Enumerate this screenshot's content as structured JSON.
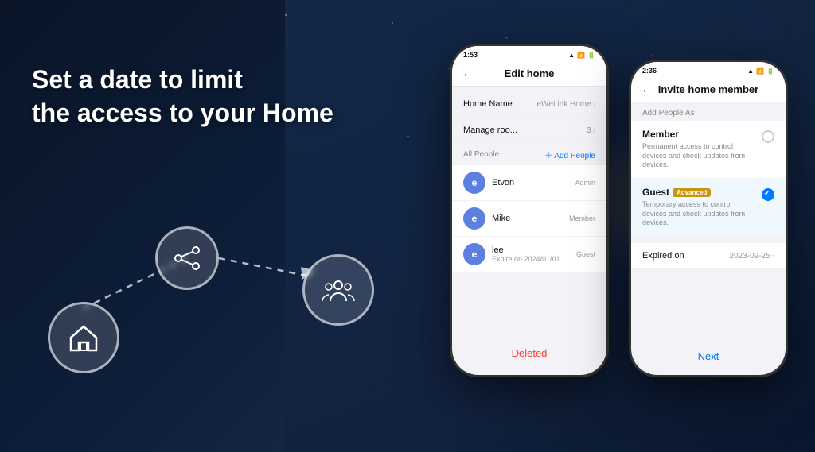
{
  "background": {
    "color": "#0a1628"
  },
  "hero": {
    "line1": "Set a date to limit",
    "line2": "the access to your Home"
  },
  "phone1": {
    "statusBar": {
      "time": "1:53",
      "icons": "🔋▲"
    },
    "header": {
      "back": "←",
      "title": "Edit home"
    },
    "listItems": [
      {
        "label": "Home Name",
        "value": "eWeLink Home",
        "hasChevron": true
      },
      {
        "label": "Manage roo...",
        "value": "3",
        "hasChevron": true
      }
    ],
    "sectionHeader": {
      "left": "All People",
      "right": "＋ Add People"
    },
    "people": [
      {
        "initial": "e",
        "name": "Etvon",
        "role": "Admin",
        "expire": ""
      },
      {
        "initial": "e",
        "name": "Mike",
        "role": "Member",
        "expire": ""
      },
      {
        "initial": "e",
        "name": "lee",
        "role": "Guest",
        "expire": "Expire on 2024/01/01"
      }
    ],
    "deleteBtn": "Deleted"
  },
  "phone2": {
    "statusBar": {
      "time": "2:36",
      "icons": "🔋"
    },
    "header": {
      "back": "←",
      "title": "Invite home member"
    },
    "sectionLabel": "Add People As",
    "options": [
      {
        "label": "Member",
        "badge": "",
        "description": "Permanent access to control devices and check updates from devices.",
        "selected": false
      },
      {
        "label": "Guest",
        "badge": "Advanced",
        "description": "Temporary access to control devices and check updates from devices.",
        "selected": true
      }
    ],
    "expiredLabel": "Expired on",
    "expiredValue": "2023-09-25",
    "nextBtn": "Next"
  },
  "icons": {
    "home": "⌂",
    "share": "⋈",
    "people": "👥",
    "back": "←",
    "addPeople": "＋ Add People",
    "chevron": "›"
  }
}
